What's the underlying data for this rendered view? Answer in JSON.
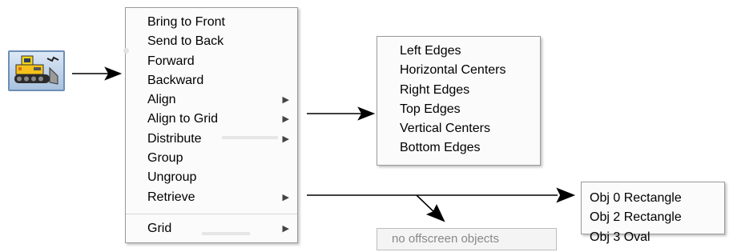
{
  "toolbar": {
    "icon": "bulldozer-icon"
  },
  "main_menu": {
    "items": [
      {
        "label": "Bring to Front",
        "submenu": false
      },
      {
        "label": "Send to Back",
        "submenu": false
      },
      {
        "label": "Forward",
        "submenu": false
      },
      {
        "label": "Backward",
        "submenu": false
      },
      {
        "label": "Align",
        "submenu": true
      },
      {
        "label": "Align to Grid",
        "submenu": true
      },
      {
        "label": "Distribute",
        "submenu": true
      },
      {
        "label": "Group",
        "submenu": false
      },
      {
        "label": "Ungroup",
        "submenu": false
      },
      {
        "label": "Retrieve",
        "submenu": true
      }
    ],
    "footer_item": {
      "label": "Grid",
      "submenu": true
    },
    "submenu_glyph": "▶"
  },
  "align_menu": {
    "items": [
      "Left Edges",
      "Horizontal Centers",
      "Right Edges",
      "Top Edges",
      "Vertical Centers",
      "Bottom Edges"
    ]
  },
  "retrieve_menu": {
    "items": [
      "Obj 0 Rectangle",
      "Obj 2 Rectangle",
      "Obj 3 Oval"
    ]
  },
  "offscreen_menu": {
    "label": "no offscreen objects"
  }
}
